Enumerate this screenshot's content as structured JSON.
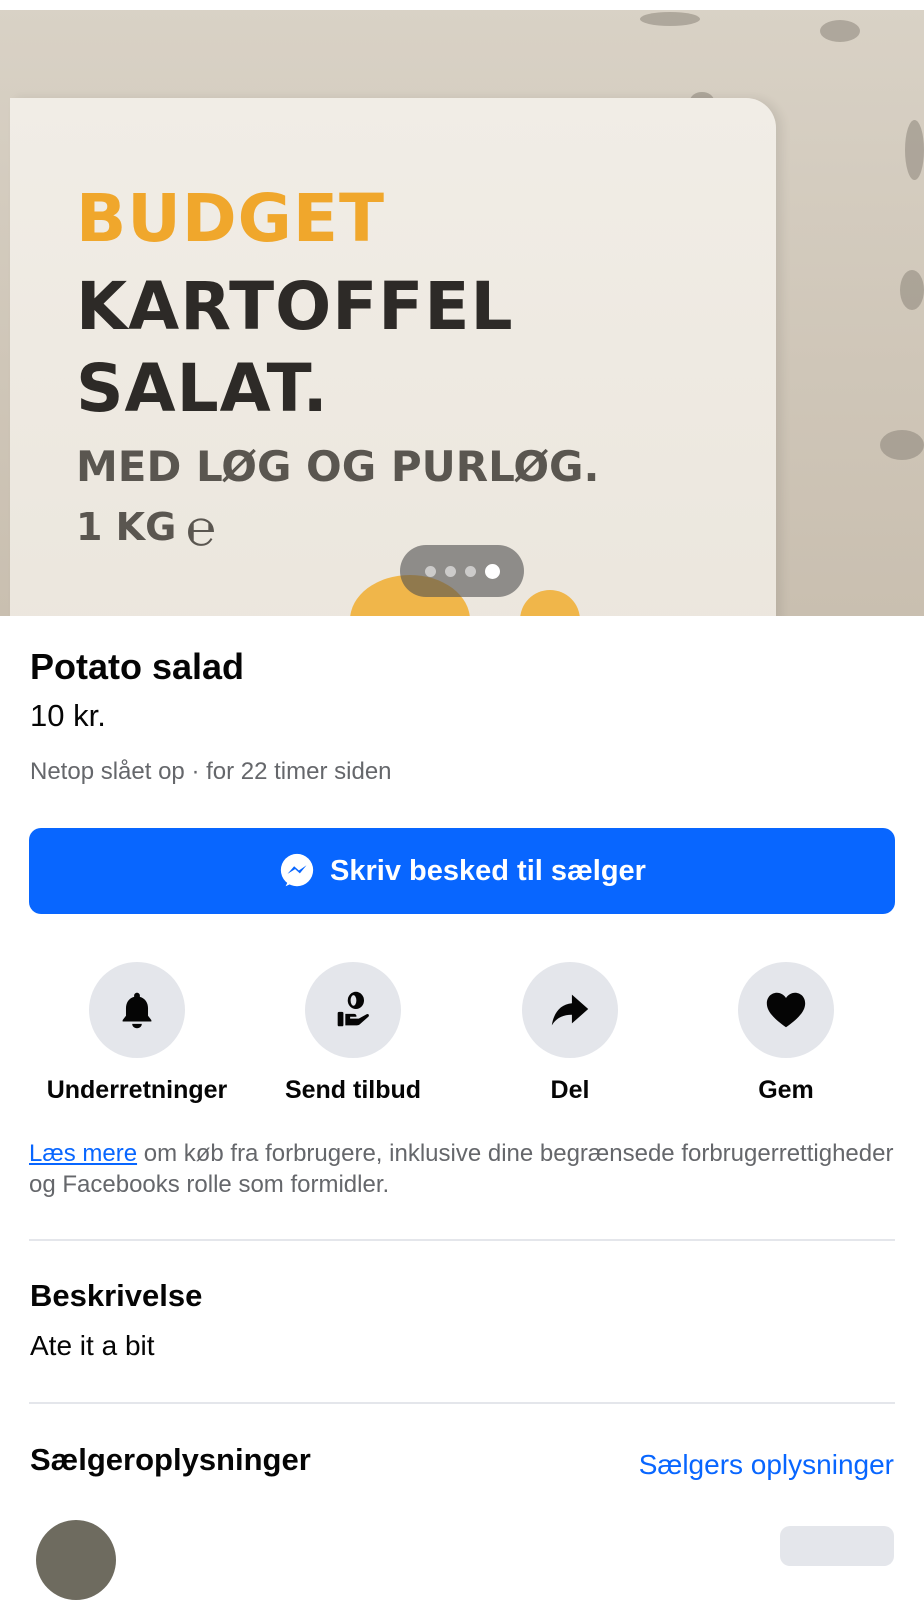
{
  "photo": {
    "text_line1": "BUDGET",
    "text_line2": "KARTOFFEL",
    "text_line3": "SALAT.",
    "text_line4": "MED LØG OG PURLØG.",
    "text_line5": "1 KG",
    "estamp": "℮",
    "carousel": {
      "count": 4,
      "active_index": 3
    }
  },
  "listing": {
    "title": "Potato salad",
    "price": "10 kr.",
    "meta": "Netop slået op · for 22 timer siden"
  },
  "message_button": {
    "label": "Skriv besked til sælger",
    "icon": "messenger-icon",
    "color": "#0866ff"
  },
  "actions": [
    {
      "label": "Underretninger",
      "icon": "bell-icon"
    },
    {
      "label": "Send tilbud",
      "icon": "offer-icon"
    },
    {
      "label": "Del",
      "icon": "share-icon"
    },
    {
      "label": "Gem",
      "icon": "heart-icon"
    }
  ],
  "info": {
    "link": "Læs mere",
    "text": " om køb fra forbrugere, inklusive dine begrænsede forbrugerrettigheder og Facebooks rolle som formidler."
  },
  "description": {
    "heading": "Beskrivelse",
    "text": "Ate it a bit"
  },
  "seller": {
    "heading": "Sælgeroplysninger",
    "link": "Sælgers oplysninger"
  }
}
